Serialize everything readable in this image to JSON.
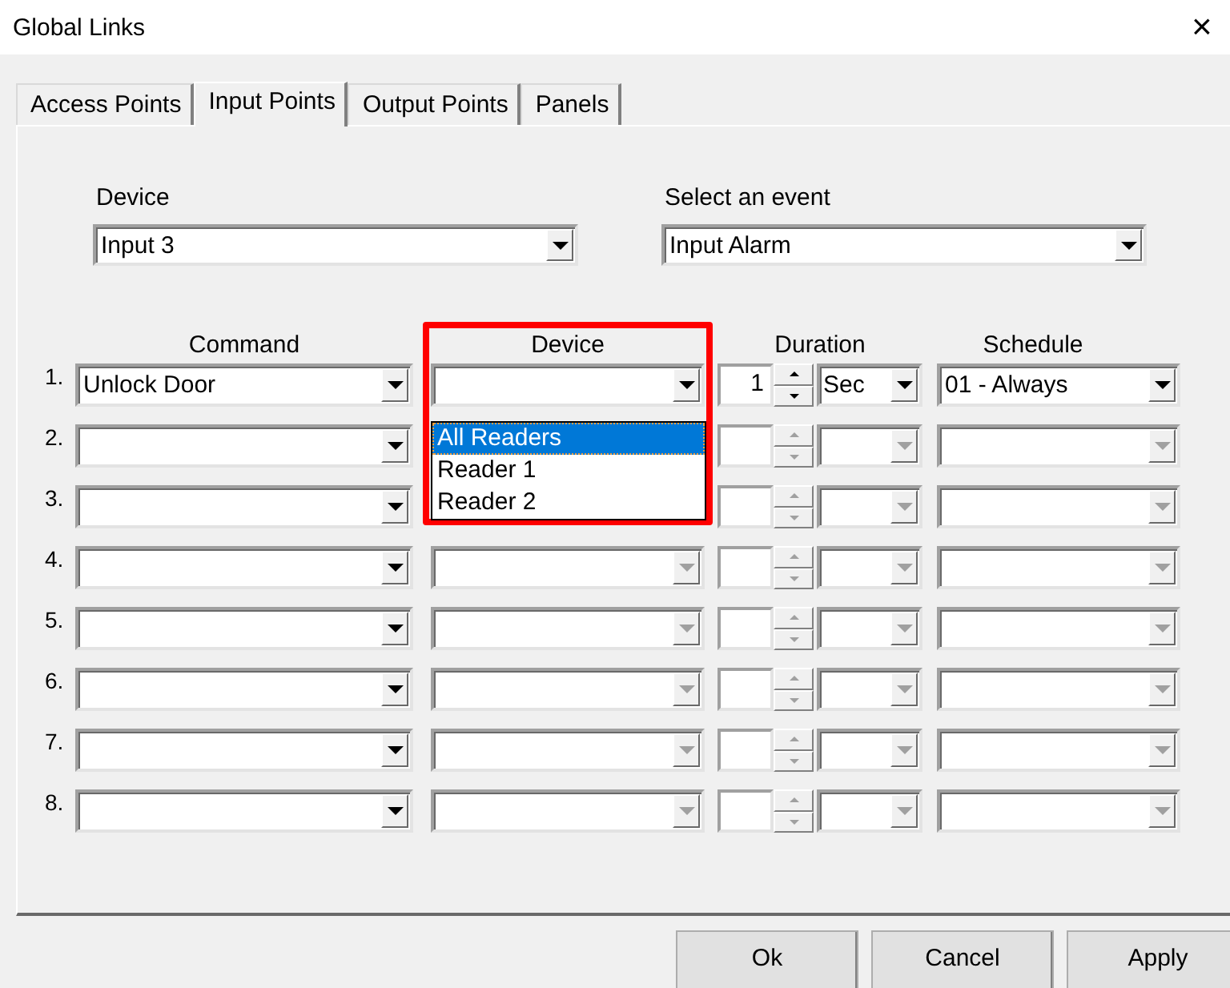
{
  "window": {
    "title": "Global Links",
    "close": "×"
  },
  "tabs": [
    {
      "label": "Access Points",
      "selected": false
    },
    {
      "label": "Input Points",
      "selected": true
    },
    {
      "label": "Output Points",
      "selected": false
    },
    {
      "label": "Panels",
      "selected": false
    }
  ],
  "device": {
    "label": "Device",
    "value": "Input 3"
  },
  "event": {
    "label": "Select an event",
    "value": "Input Alarm"
  },
  "columns": [
    "Command",
    "Device",
    "Duration",
    "Schedule"
  ],
  "rows": [
    {
      "number": "1.",
      "command": "Unlock Door",
      "duration": "1",
      "unit": "Sec",
      "schedule": "01 - Always",
      "disabled": false
    },
    {
      "number": "2.",
      "disabled": true
    },
    {
      "number": "3.",
      "disabled": true
    },
    {
      "number": "4.",
      "disabled": true
    },
    {
      "number": "5.",
      "disabled": true
    },
    {
      "number": "6.",
      "disabled": true
    },
    {
      "number": "7.",
      "disabled": true
    },
    {
      "number": "8.",
      "disabled": true
    }
  ],
  "device_dropdown": {
    "items": [
      {
        "label": "All Readers",
        "selected": true
      },
      {
        "label": "Reader 1",
        "selected": false
      },
      {
        "label": "Reader 2",
        "selected": false
      }
    ]
  },
  "buttons": [
    "Ok",
    "Cancel",
    "Apply"
  ]
}
